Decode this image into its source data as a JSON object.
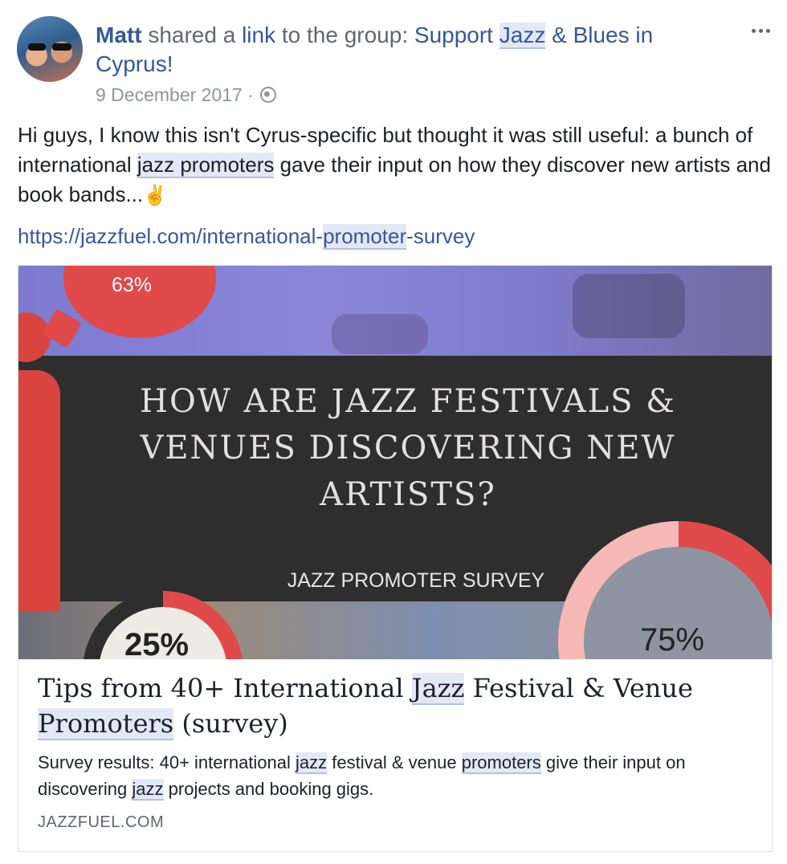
{
  "post": {
    "author": "Matt",
    "action": "shared a",
    "link_word": "link",
    "to_group": "to the group:",
    "group_pre": "Support",
    "group_hl": "Jazz",
    "group_post": "& Blues in Cyprus!",
    "date": "9 December 2017",
    "dot": "·",
    "text_1": "Hi guys, I know this isn't Cyrus-specific but thought it was still useful: a bunch of international",
    "text_hl": "jazz promoters",
    "text_2": "gave their input on how they discover new artists and book bands...",
    "emoji": "✌",
    "url_pre": "https://jazzfuel.com/international-",
    "url_hl": "promoter",
    "url_post": "-survey"
  },
  "hero": {
    "bubble_pct": "63%",
    "title": "HOW ARE JAZZ FESTIVALS & VENUES DISCOVERING NEW ARTISTS?",
    "subtitle": "JAZZ PROMOTER SURVEY",
    "right_pct": "75%",
    "left_pct": "25%"
  },
  "card": {
    "title_pre": "Tips from 40+ International",
    "title_hl1": "Jazz",
    "title_mid": "Festival & Venue",
    "title_hl2": "Promoters",
    "title_post": "(survey)",
    "desc_1": "Survey results: 40+ international",
    "desc_hl1": "jazz",
    "desc_2": "festival & venue",
    "desc_hl2": "promoters",
    "desc_3": "give their input on discovering",
    "desc_hl3": "jazz",
    "desc_4": "projects and booking gigs.",
    "domain": "JAZZFUEL.COM"
  },
  "icons": {
    "more": "more-options-icon",
    "globe": "globe-icon"
  }
}
